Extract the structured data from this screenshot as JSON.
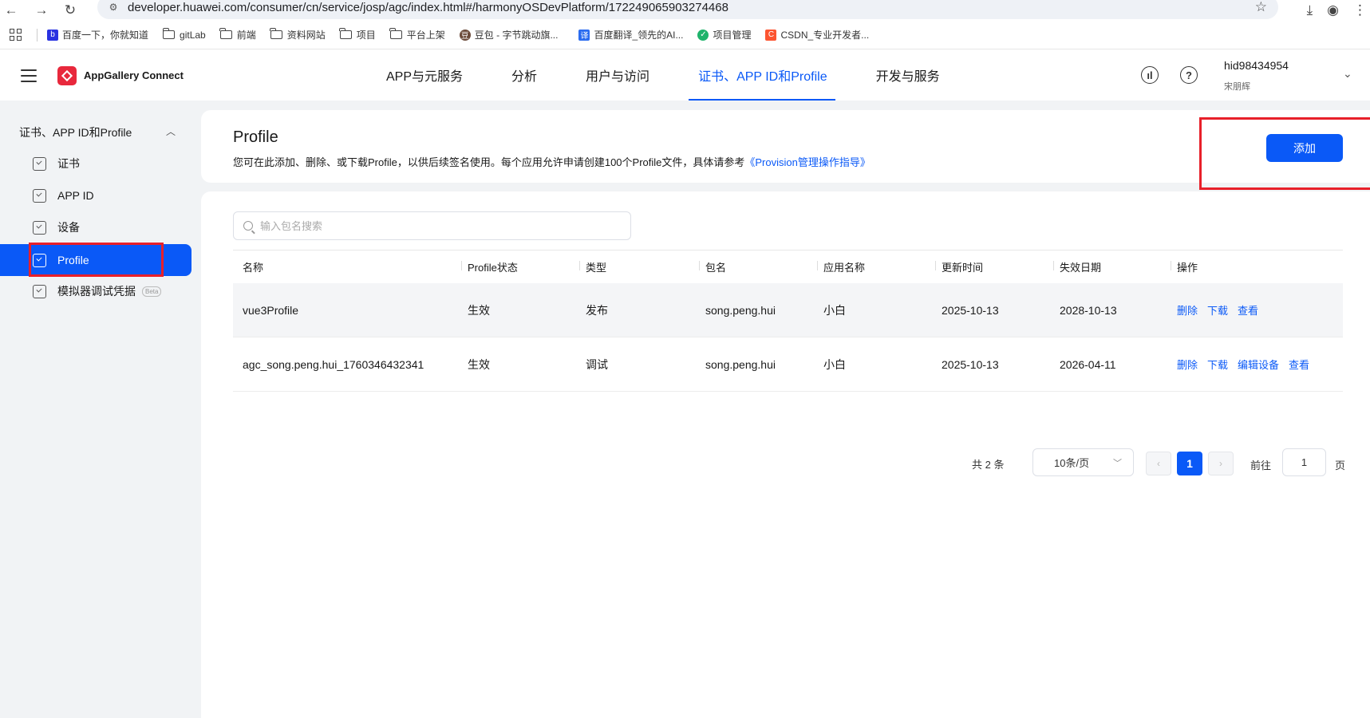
{
  "browser": {
    "url": "developer.huawei.com/consumer/cn/service/josp/agc/index.html#/harmonyOSDevPlatform/172249065903274468",
    "bookmarks": [
      {
        "label": "百度一下，你就知道",
        "icon": "baidu-icon",
        "color": "#2932e1"
      },
      {
        "label": "gitLab",
        "icon": "folder-icon"
      },
      {
        "label": "前端",
        "icon": "folder-icon"
      },
      {
        "label": "资料网站",
        "icon": "folder-icon"
      },
      {
        "label": "项目",
        "icon": "folder-icon"
      },
      {
        "label": "平台上架",
        "icon": "folder-icon"
      },
      {
        "label": "豆包 - 字节跳动旗...",
        "icon": "doubao-icon",
        "color": "#6b4a3a"
      },
      {
        "label": "百度翻译_领先的AI...",
        "icon": "baidu-translate-icon",
        "color": "#2b6cf0"
      },
      {
        "label": "项目管理",
        "icon": "project-icon",
        "color": "#1fb36b"
      },
      {
        "label": "CSDN_专业开发者...",
        "icon": "csdn-icon",
        "color": "#fc5531"
      }
    ]
  },
  "header": {
    "brand": "AppGallery Connect",
    "tabs": [
      {
        "label": "APP与元服务",
        "active": false
      },
      {
        "label": "分析",
        "active": false
      },
      {
        "label": "用户与访问",
        "active": false
      },
      {
        "label": "证书、APP ID和Profile",
        "active": true
      },
      {
        "label": "开发与服务",
        "active": false
      }
    ],
    "user": {
      "name": "hid98434954",
      "sub": "宋朋辉"
    }
  },
  "sidebar": {
    "group": "证书、APP ID和Profile",
    "items": [
      {
        "label": "证书",
        "active": false
      },
      {
        "label": "APP ID",
        "active": false
      },
      {
        "label": "设备",
        "active": false
      },
      {
        "label": "Profile",
        "active": true
      },
      {
        "label": "模拟器调试凭据",
        "active": false,
        "badge": "Beta"
      }
    ]
  },
  "page": {
    "title": "Profile",
    "desc": "您可在此添加、删除、或下载Profile，以供后续签名使用。每个应用允许申请创建100个Profile文件，具体请参考",
    "desc_link": "《Provision管理操作指导》",
    "add_button": "添加",
    "search_placeholder": "输入包名搜索"
  },
  "table": {
    "columns": [
      "名称",
      "Profile状态",
      "类型",
      "包名",
      "应用名称",
      "更新时间",
      "失效日期",
      "操作"
    ],
    "rows": [
      {
        "name": "vue3Profile",
        "status": "生效",
        "type": "发布",
        "package": "song.peng.hui",
        "app": "小白",
        "updated": "2025-10-13",
        "expires": "2028-10-13",
        "actions": [
          "删除",
          "下载",
          "查看"
        ]
      },
      {
        "name": "agc_song.peng.hui_1760346432341",
        "status": "生效",
        "type": "调试",
        "package": "song.peng.hui",
        "app": "小白",
        "updated": "2025-10-13",
        "expires": "2026-04-11",
        "actions": [
          "删除",
          "下载",
          "编辑设备",
          "查看"
        ]
      }
    ]
  },
  "pagination": {
    "total": "共 2 条",
    "page_size": "10条/页",
    "current": "1",
    "goto_label": "前往",
    "goto_value": "1",
    "unit": "页"
  },
  "colors": {
    "accent": "#0a59f7",
    "annotation": "#e8202a",
    "brand": "#e8283c"
  }
}
